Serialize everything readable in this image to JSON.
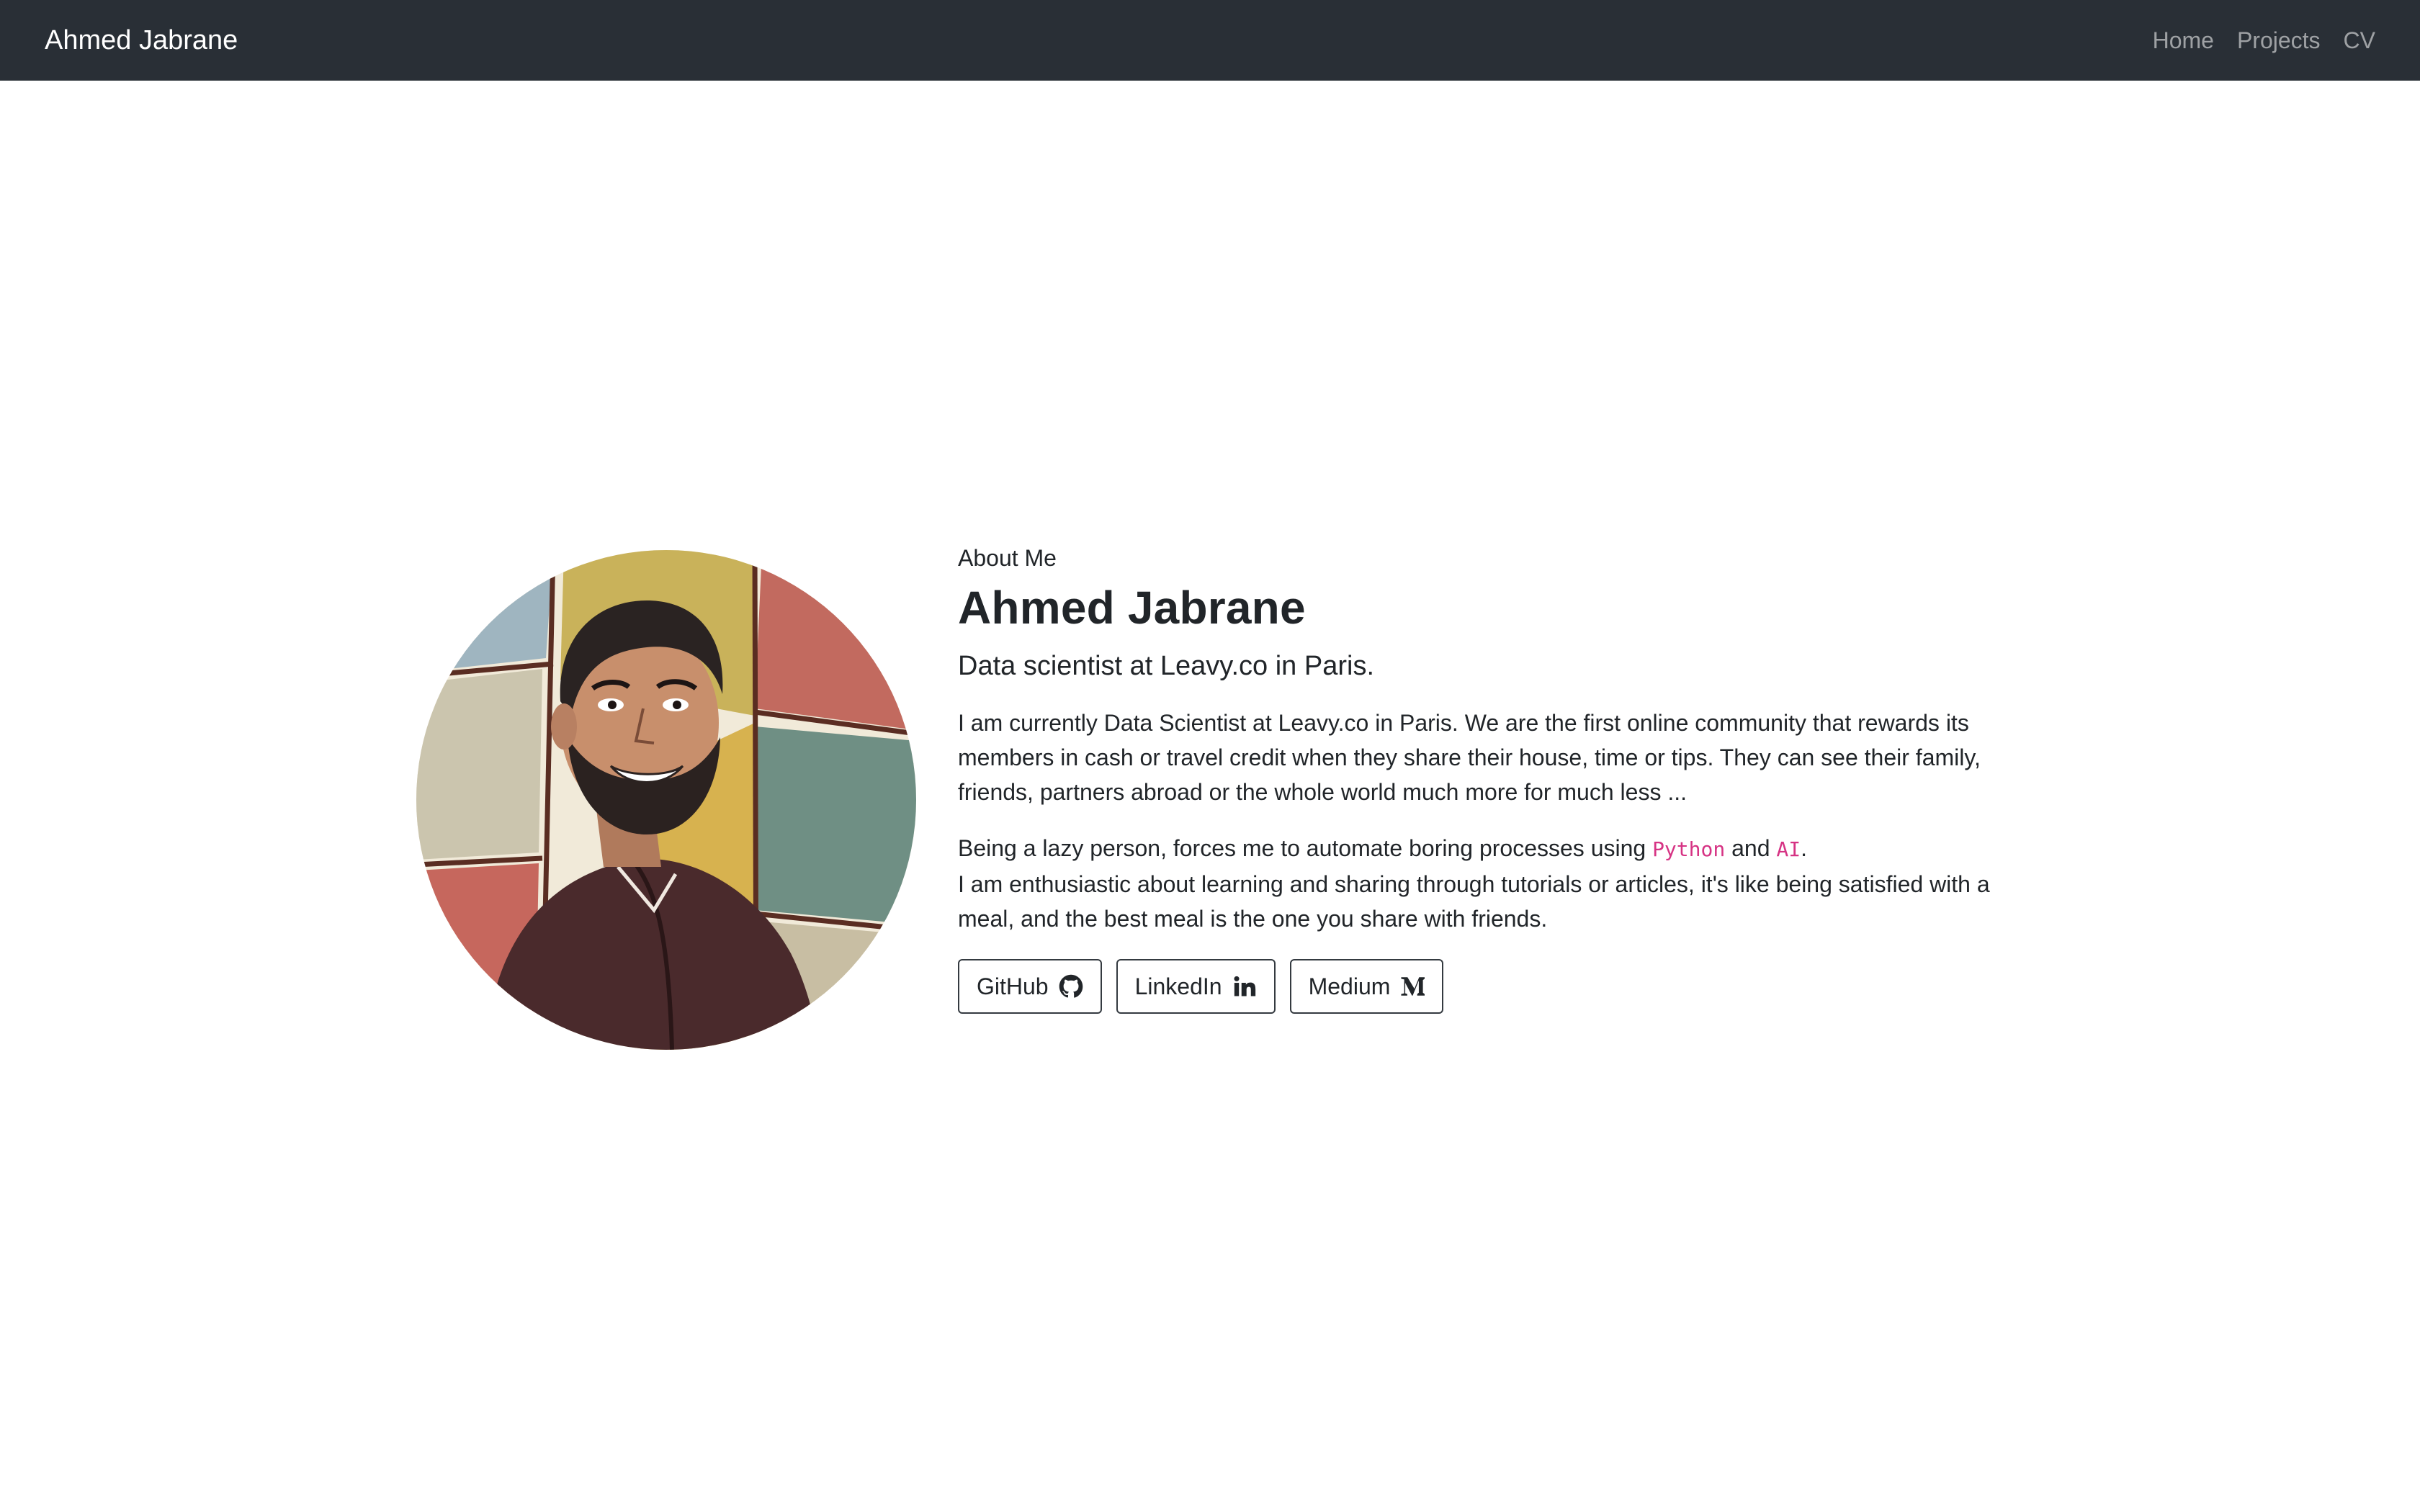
{
  "navbar": {
    "brand": "Ahmed Jabrane",
    "links": [
      {
        "label": "Home"
      },
      {
        "label": "Projects"
      },
      {
        "label": "CV"
      }
    ]
  },
  "hero": {
    "eyebrow": "About Me",
    "name": "Ahmed Jabrane",
    "tagline": "Data scientist at Leavy.co in Paris.",
    "paragraph1": "I am currently Data Scientist at Leavy.co in Paris. We are the first online community that rewards its members in cash or travel credit when they share their house, time or tips. They can see their family, friends, partners abroad or the whole world much more for much less ...",
    "paragraph2": {
      "before": "Being a lazy person, forces me to automate boring processes using ",
      "code1": "Python",
      "between": " and ",
      "code2": "AI",
      "after": ".",
      "line2": "I am enthusiastic about learning and sharing through tutorials or articles, it's like being satisfied with a meal, and the best meal is the one you share with friends."
    },
    "buttons": [
      {
        "label": "GitHub",
        "icon": "github-icon"
      },
      {
        "label": "LinkedIn",
        "icon": "linkedin-icon"
      },
      {
        "label": "Medium",
        "icon": "medium-icon"
      }
    ]
  },
  "colors": {
    "navbar_bg": "#292f36",
    "code_text": "#d63384",
    "button_border": "#343a40"
  }
}
